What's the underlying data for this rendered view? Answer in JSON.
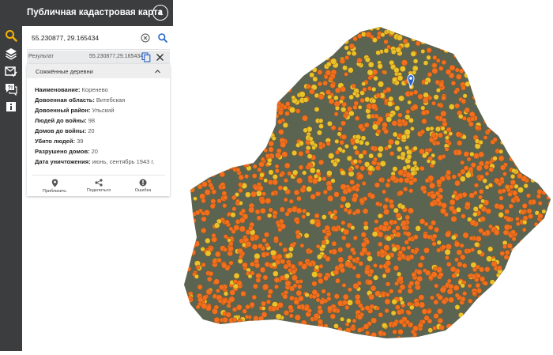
{
  "header": {
    "title": "Публичная кадастровая карта"
  },
  "search": {
    "value": "55.230877, 29.165434"
  },
  "result": {
    "label": "Результат",
    "value": "55.230877,29.165434"
  },
  "card": {
    "title": "Сожжённые деревни",
    "fields": [
      {
        "key": "Наименование:",
        "value": "Коренево"
      },
      {
        "key": "Довоенная область:",
        "value": "Витебская"
      },
      {
        "key": "Довоенный район:",
        "value": "Ульский"
      },
      {
        "key": "Людей до войны:",
        "value": "98"
      },
      {
        "key": "Домов до войны:",
        "value": "20"
      },
      {
        "key": "Убито людей:",
        "value": "39"
      },
      {
        "key": "Разрушено домов:",
        "value": "20"
      },
      {
        "key": "Дата уничтожения:",
        "value": "июнь, сентябрь 1943 г."
      }
    ],
    "actions": {
      "zoom": "Приблизить",
      "share": "Поделиться",
      "error": "Ошибка"
    }
  },
  "colors": {
    "chrome": "#3c3d3f",
    "accent": "#f5b400",
    "orange": "#f26f1e",
    "yellow": "#e9c32a",
    "marker": "#2563c9"
  },
  "icons": [
    "search-icon",
    "layers-icon",
    "mail-check-icon",
    "chat-question-icon",
    "info-icon",
    "chevron-left-icon",
    "clear-icon",
    "copy-icon",
    "close-icon",
    "chevron-up-icon",
    "location-pin-icon",
    "share-icon",
    "error-icon"
  ]
}
